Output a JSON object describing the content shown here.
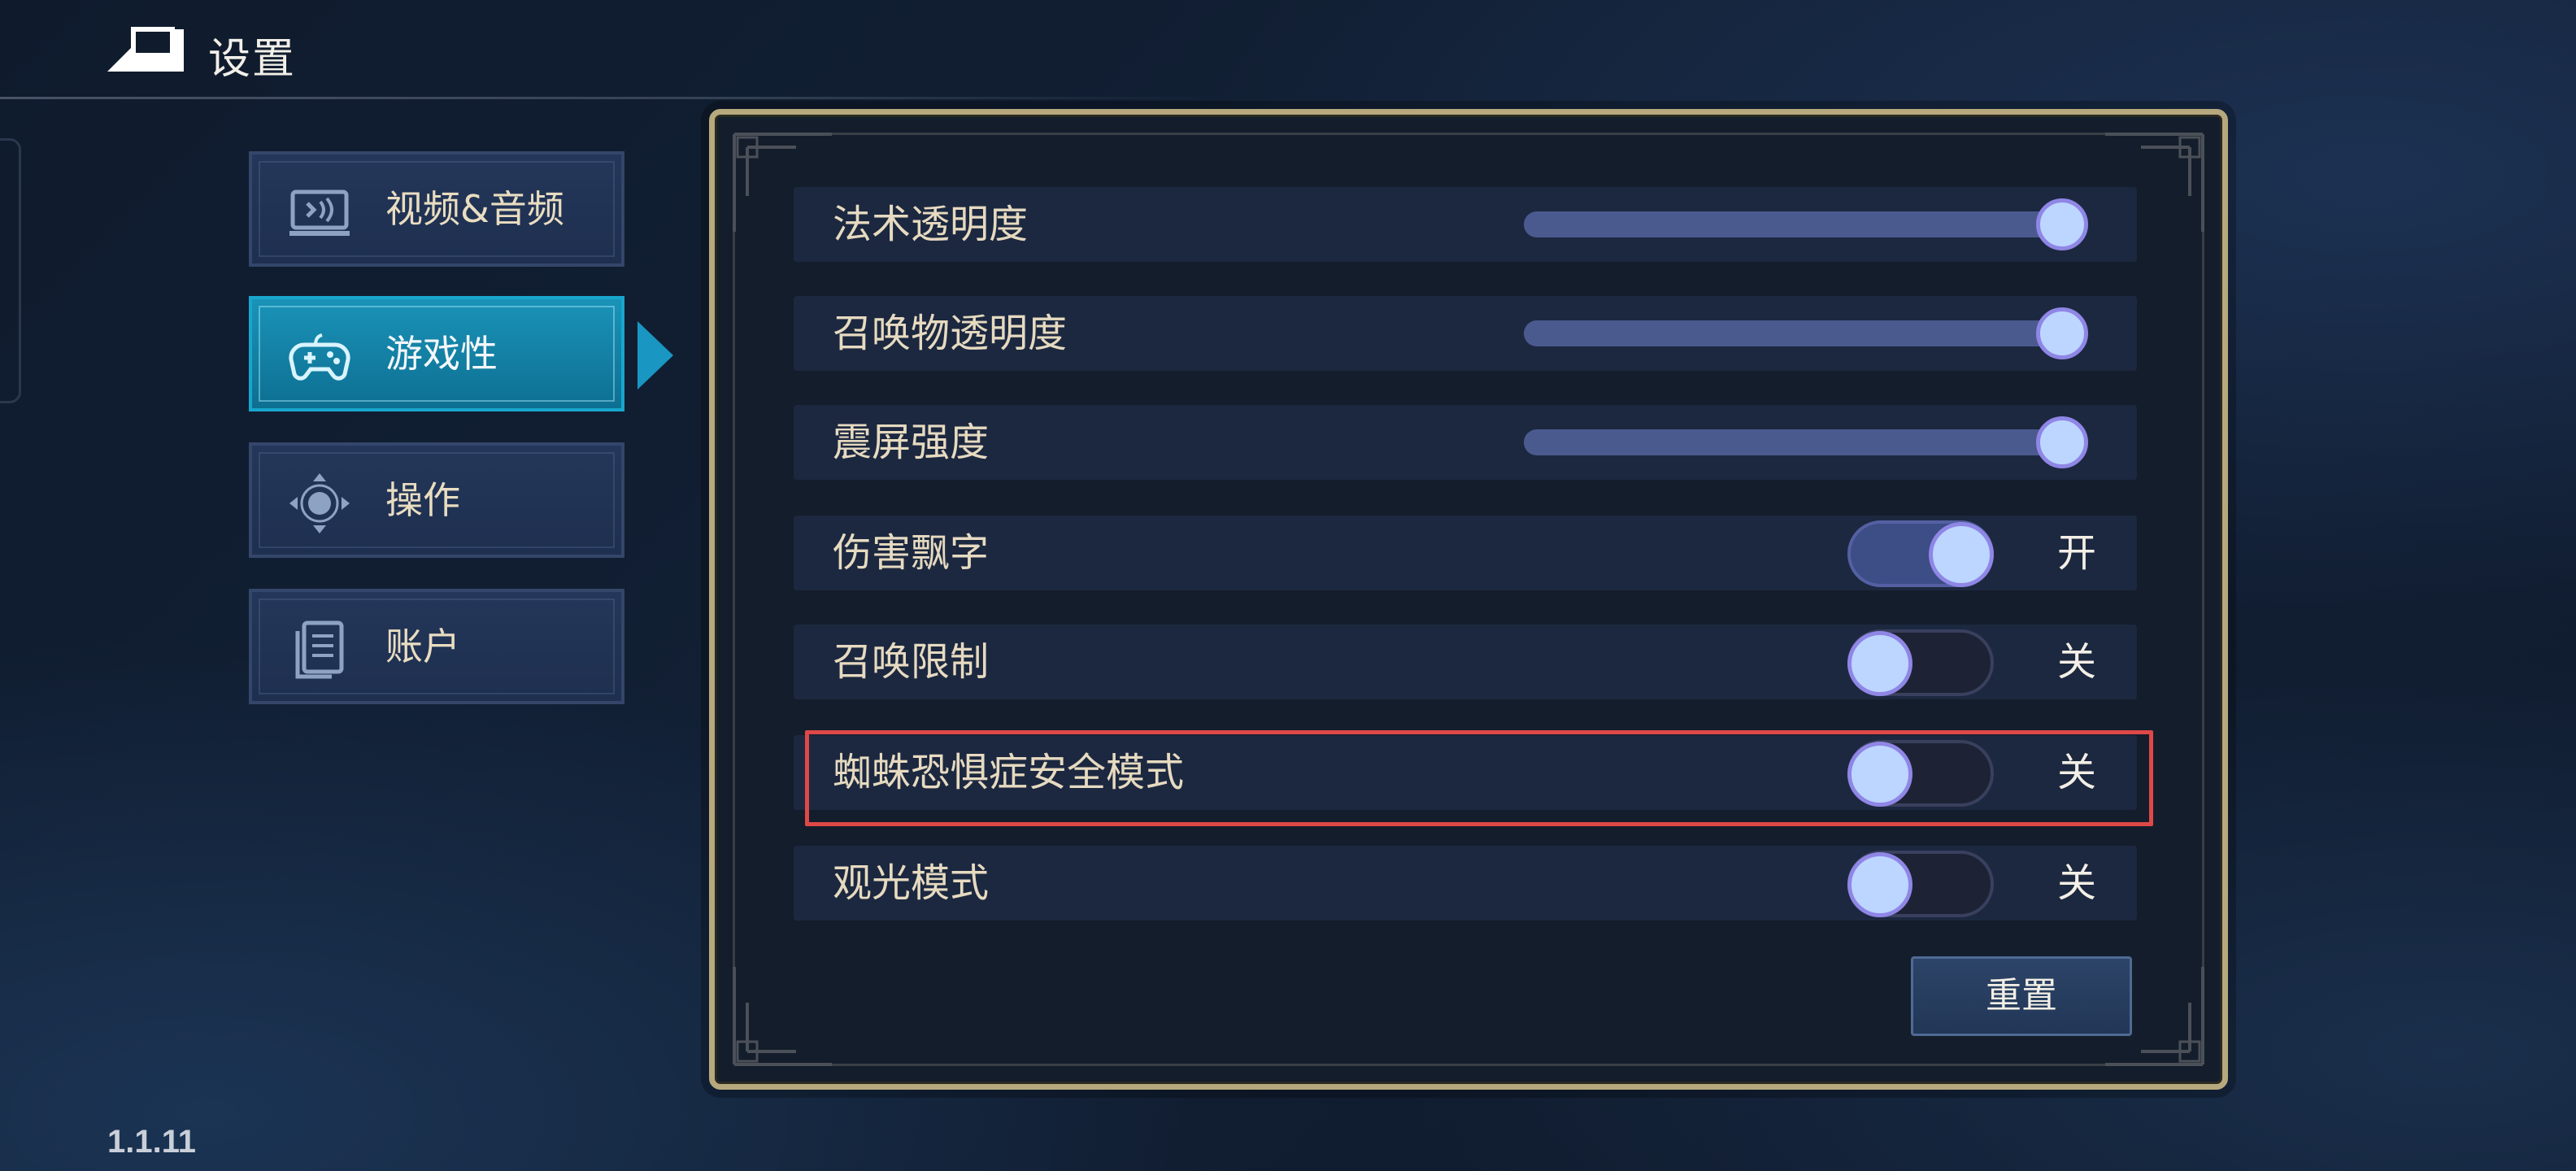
{
  "header": {
    "title": "设置",
    "back_icon": "back-arrow-icon"
  },
  "sidebar": {
    "items": [
      {
        "label": "视频&音频",
        "icon": "monitor-sound-icon",
        "active": false
      },
      {
        "label": "游戏性",
        "icon": "gamepad-icon",
        "active": true
      },
      {
        "label": "操作",
        "icon": "dpad-icon",
        "active": false
      },
      {
        "label": "账户",
        "icon": "document-icon",
        "active": false
      }
    ]
  },
  "settings": {
    "sliders": [
      {
        "label": "法术透明度",
        "value": 1.0
      },
      {
        "label": "召唤物透明度",
        "value": 1.0
      },
      {
        "label": "震屏强度",
        "value": 1.0
      }
    ],
    "toggles": [
      {
        "label": "伤害飘字",
        "on": true,
        "state": "开"
      },
      {
        "label": "召唤限制",
        "on": false,
        "state": "关"
      },
      {
        "label": "蜘蛛恐惧症安全模式",
        "on": false,
        "state": "关",
        "highlighted": true
      },
      {
        "label": "观光模式",
        "on": false,
        "state": "关"
      }
    ],
    "reset_label": "重置"
  },
  "version": "1.1.11",
  "colors": {
    "accent": "#1996c2",
    "highlight": "#e04848",
    "knob": "#bcd6ff",
    "frame": "#b7a97d"
  }
}
